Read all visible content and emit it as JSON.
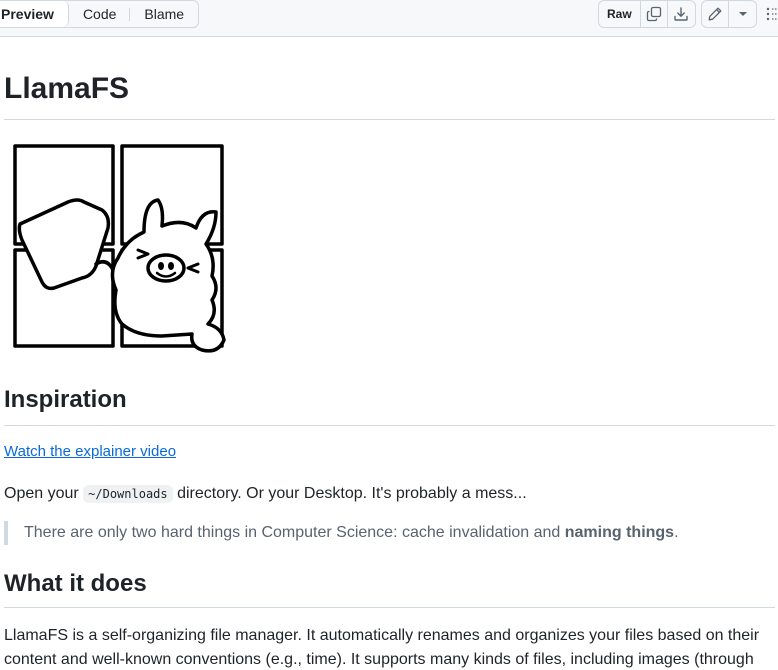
{
  "toolbar": {
    "tabs": [
      {
        "label": "Preview",
        "active": true
      },
      {
        "label": "Code",
        "active": false
      },
      {
        "label": "Blame",
        "active": false
      }
    ],
    "raw_label": "Raw",
    "icons": [
      "copy-icon",
      "download-icon",
      "pencil-icon",
      "triangle-down-icon",
      "kebab-icon"
    ]
  },
  "readme": {
    "title": "LlamaFS",
    "inspiration_heading": "Inspiration",
    "video_link": "Watch the explainer video",
    "intro_before": "Open your ",
    "intro_code": "~/Downloads",
    "intro_after": " directory. Or your Desktop. It's probably a mess...",
    "quote_text": "There are only two hard things in Computer Science: cache invalidation and ",
    "quote_bold": "naming things",
    "quote_end": ".",
    "what_heading": "What it does",
    "desc_line1": "LlamaFS is a self-organizing file manager. It automatically renames and organizes your files based on their",
    "desc_line2": "content and well-known conventions (e.g., time). It supports many kinds of files, including images (through"
  },
  "colors": {
    "link": "#0969da",
    "border": "#d1d9e0",
    "text": "#1f2328",
    "muted": "#59636e"
  }
}
